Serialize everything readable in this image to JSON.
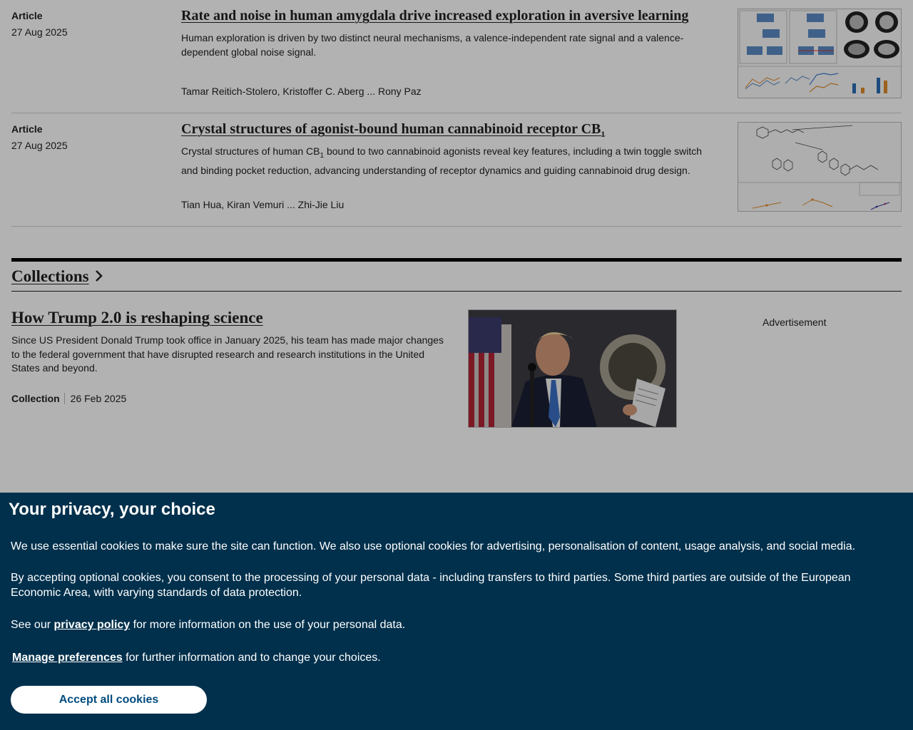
{
  "articles": [
    {
      "type": "Article",
      "date": "27 Aug 2025",
      "title": "Rate and noise in human amygdala drive increased exploration in aversive learning",
      "description": "Human exploration is driven by two distinct neural mechanisms, a valence-independent rate signal and a valence-dependent global noise signal.",
      "authors": "Tamar Reitich-Stolero, Kristoffer C. Aberg ... Rony Paz"
    },
    {
      "type": "Article",
      "date": "27 Aug 2025",
      "title": "Crystal structures of agonist-bound human cannabinoid receptor CB",
      "title_subscript": "1",
      "description_pre": "Crystal structures of human CB",
      "description_subscript": "1",
      "description_post": " bound to two cannabinoid agonists reveal key features, including a twin toggle switch and binding pocket reduction, advancing understanding of receptor dynamics and guiding cannabinoid drug design.",
      "authors": "Tian Hua, Kiran Vemuri ... Zhi-Jie Liu"
    }
  ],
  "collections": {
    "header": "Collections",
    "item": {
      "title": "How Trump 2.0 is reshaping science",
      "description": "Since US President Donald Trump took office in January 2025, his team has made major changes to the federal government that have disrupted research and research institutions in the United States and beyond.",
      "type": "Collection",
      "date": "26 Feb 2025"
    }
  },
  "advertisement_label": "Advertisement",
  "cookie_banner": {
    "title": "Your privacy, your choice",
    "p1": "We use essential cookies to make sure the site can function. We also use optional cookies for advertising, personalisation of content, usage analysis, and social media.",
    "p2": "By accepting optional cookies, you consent to the processing of your personal data - including transfers to third parties. Some third parties are outside of the European Economic Area, with varying standards of data protection.",
    "p3_pre": "See our ",
    "p3_link": "privacy policy",
    "p3_post": " for more information on the use of your personal data.",
    "manage_label": "Manage preferences",
    "p4_post": " for further information and to change your choices.",
    "accept_label": "Accept all cookies"
  },
  "colors": {
    "banner_bg": "#00304c",
    "accept_text": "#004c7f",
    "overlay": "rgba(0,0,0,0.3)"
  }
}
